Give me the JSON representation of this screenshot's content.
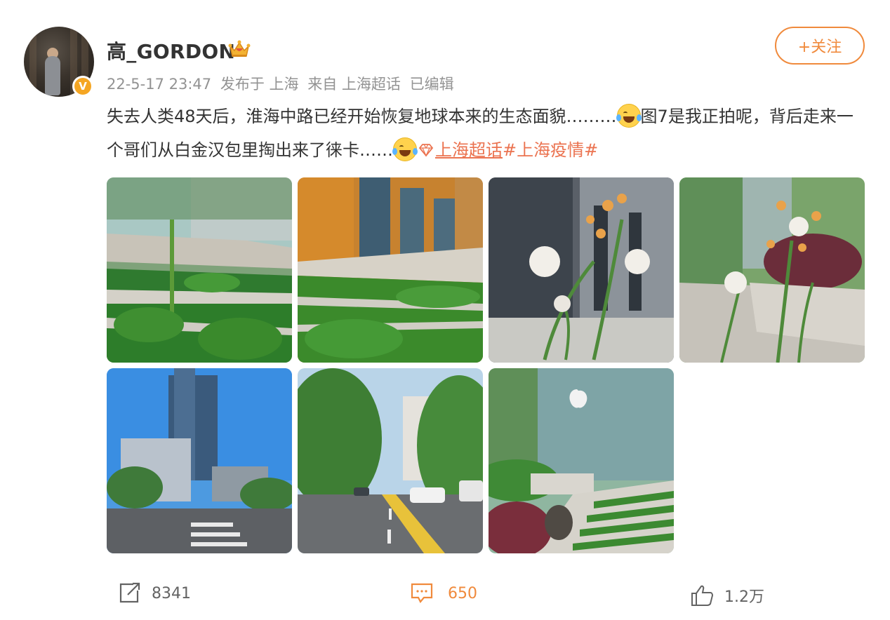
{
  "user": {
    "name": "高_GORDON",
    "verified_badge": "V"
  },
  "follow_button": {
    "label": "+关注"
  },
  "meta": {
    "date": "22-5-17 23:47",
    "posted_at": "发布于 上海",
    "source": "来自 上海超话",
    "edited": "已编辑"
  },
  "post": {
    "text_part1": "失去人类48天后，淮海中路已经开始恢复地球本来的生态面貌………",
    "text_part2": "图7是我正拍呢，背后走来一个哥们从白金汉包里掏出来了徕卡……",
    "topic_link": "上海超话",
    "hashtag": "#上海疫情#"
  },
  "images": [
    {
      "name": "photo-steps-weeds-1"
    },
    {
      "name": "photo-steps-weeds-2"
    },
    {
      "name": "photo-dandelion-1"
    },
    {
      "name": "photo-dandelion-2"
    },
    {
      "name": "photo-tower-street"
    },
    {
      "name": "photo-empty-road"
    },
    {
      "name": "photo-apple-store-steps"
    }
  ],
  "actions": {
    "repost_count": "8341",
    "comment_count": "650",
    "like_count": "1.2万"
  },
  "colors": {
    "accent": "#f08a3c",
    "topic": "#eb7350",
    "meta": "#939393",
    "verified": "#f5a623"
  }
}
